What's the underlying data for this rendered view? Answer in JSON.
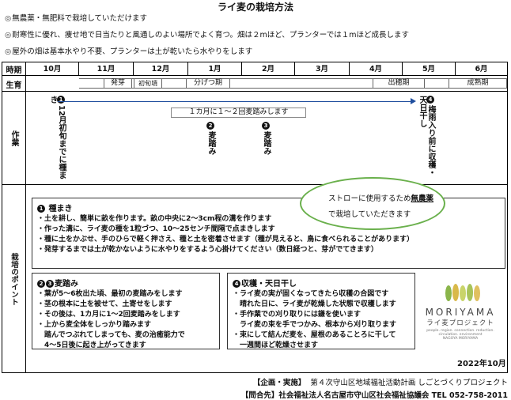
{
  "title": "ライ麦の栽培方法",
  "intro": [
    "無農薬・無肥料で栽培していただけます",
    "耐寒性に優れ、痩せ地で日当たりと風通しのよい場所でよく育つ。畑は２mほど、プランターでは１mほど成長します",
    "屋外の畑は基本水やり不要、プランターは土が乾いたら水やりをします"
  ],
  "intro_mark": "◎",
  "table": {
    "month_header": "時期",
    "months": [
      "10月",
      "11月",
      "12月",
      "1月",
      "2月",
      "3月",
      "4月",
      "5月",
      "6月"
    ],
    "growth_header": "生育",
    "stages": {
      "germination": "発芽",
      "early_growth": "初旬頃",
      "tillering": "分げつ期",
      "heading": "出穂期",
      "ripening": "成熟期"
    },
    "work_header": "作業",
    "tasks": [
      {
        "num": "1",
        "text": "12月初旬までに種まき"
      },
      {
        "num": "2",
        "text": "麦踏み"
      },
      {
        "num": "3",
        "text": "麦踏み"
      },
      {
        "num": "4",
        "text": "梅雨入り前に収穫・天日干し"
      }
    ],
    "monthly_note": "１カ月に１～２回麦踏みします"
  },
  "points": {
    "header": "栽培のポイント",
    "sowing": {
      "num": "1",
      "title": "種まき",
      "lines": [
        "・土を耕し、簡単に畝を作ります。畝の中央に2～3cm程の溝を作ります",
        "・作った溝に、ライ麦の種を1粒づつ、10～25センチ間隔で点まきします",
        "・種に土をかぶせ、手のひらで軽く押さえ、種と土を密着させます（種が見えると、鳥に食べられることがあります）",
        "・発芽するまでは土が乾かないように水やりをするよう心掛けてください（数日経つと、芽がでてきます）"
      ]
    },
    "note": {
      "line1_pre": "ストローに使用するため",
      "line1_em": "無農薬",
      "line2": "で栽培していただきます"
    },
    "treading": {
      "num": "2",
      "num2": "3",
      "title": "麦踏み",
      "lines": [
        "・葉が5～6枚出た頃、最初の麦踏みをします",
        "・茎の根本に土を被せて、土寄せをします",
        "・その後は、1カ月に1～2回麦踏みをします",
        "・上から麦全体をしっかり踏みます",
        "　踏んでつぶれてしまっても、麦の治癒能力で",
        "　4～5日後に起き上がってきます"
      ]
    },
    "harvest": {
      "num": "4",
      "title": "収穫・天日干し",
      "lines": [
        "・ライ麦の実が固くなってきたら収穫の合図です",
        "　晴れた日に、ライ麦が乾燥した状態で収穫します",
        "・手作業での刈り取りには鎌を使います",
        "　ライ麦の束を手でつかみ、根本から刈り取ります",
        "・束にして結んだ麦を、屋根のあることろに干して",
        "　一週間ほど乾燥させます"
      ]
    }
  },
  "logo": {
    "name": "MORIYAMA",
    "sub": "ライ麦プロジェクト",
    "tagline1": "people. region. connection. reduction.",
    "tagline2": "circulation. environment",
    "tagline3": "NAGOYA  MORIYAMA"
  },
  "date": "2022年10月",
  "footer": {
    "plan_label": "【企画・実施】",
    "plan_text": "第４次守山区地域福祉活動計画 しごとづくりプロジェクト",
    "contact_label": "【問合先】",
    "contact_text": "社会福祉法人名古屋市守山区社会福祉協議会 TEL 052-758-2011"
  },
  "colors": {
    "arrow": "#1f4e9e",
    "oval_border": "#6ab04c",
    "logo_dots": [
      "#8ab54a",
      "#d9b94a",
      "#c9d46a",
      "#a7c35a",
      "#e0c060"
    ]
  }
}
